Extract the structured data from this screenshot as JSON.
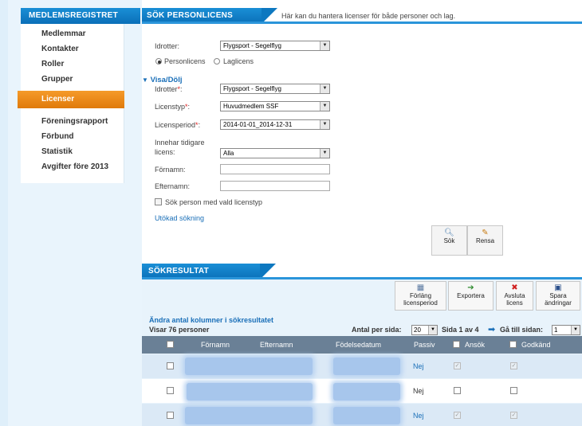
{
  "sidebar": {
    "title": "MEDLEMSREGISTRET",
    "items": [
      {
        "label": "Medlemmar"
      },
      {
        "label": "Kontakter"
      },
      {
        "label": "Roller"
      },
      {
        "label": "Grupper"
      },
      {
        "label": "Licenser"
      },
      {
        "label": "Föreningsrapport"
      },
      {
        "label": "Förbund"
      },
      {
        "label": "Statistik"
      },
      {
        "label": "Avgifter före 2013"
      }
    ]
  },
  "header": {
    "tab": "SÖK PERSONLICENS",
    "description": "Här kan du hantera licenser för både personer och lag."
  },
  "form": {
    "idrotter_label": "Idrotter:",
    "idrotter_value": "Flygsport - Segelflyg",
    "radio_person": "Personlicens",
    "radio_lag": "Laglicens",
    "visa_dolj": "Visa/Dölj",
    "idrotter2_label": "Idrotter",
    "idrotter2_value": "Flygsport - Segelflyg",
    "licenstyp_label": "Licenstyp",
    "licenstyp_value": "Huvudmedlem SSF",
    "licensperiod_label": "Licensperiod",
    "licensperiod_value": "2014-01-01_2014-12-31",
    "innehar_label_1": "Innehar tidigare",
    "innehar_label_2": "licens:",
    "innehar_value": "Alla",
    "fornamn_label": "Förnamn:",
    "fornamn_value": "",
    "efternamn_label": "Efternamn:",
    "efternamn_value": "",
    "checkbox_label": "Sök person med vald licenstyp",
    "advanced_link": "Utökad sökning",
    "sok_button": "Sök",
    "rensa_button": "Rensa"
  },
  "results": {
    "tab": "SÖKRESULTAT",
    "toolbar": {
      "forlang": [
        "Förläng",
        "licensperiod"
      ],
      "exportera": "Exportera",
      "avsluta": [
        "Avsluta",
        "licens"
      ],
      "spara": [
        "Spara",
        "ändringar"
      ]
    },
    "columns_link": "Ändra antal kolumner i sökresultatet",
    "count_text": "Visar 76 personer",
    "per_page_label": "Antal per sida:",
    "per_page_value": "20",
    "page_text": "Sida 1 av 4",
    "goto_label": "Gå till sidan:",
    "goto_value": "1",
    "table": {
      "headers": [
        "Förnamn",
        "Efternamn",
        "Födelsedatum",
        "Passiv",
        "Ansök",
        "Godkänd"
      ],
      "rows": [
        {
          "passiv": "Nej"
        },
        {
          "passiv": "Nej"
        },
        {
          "passiv": "Nej"
        }
      ]
    }
  },
  "colors": {
    "brand_blue": "#0a6fb8",
    "active_orange": "#e88a1a",
    "link_blue": "#1a6fb8",
    "table_header": "#6a8096"
  },
  "icons": {
    "sok": "magnifier-icon",
    "rensa": "brush-icon",
    "forlang": "calendar-icon",
    "exportera": "export-arrow-icon",
    "avsluta": "red-x-icon",
    "spara": "floppy-disk-icon"
  }
}
